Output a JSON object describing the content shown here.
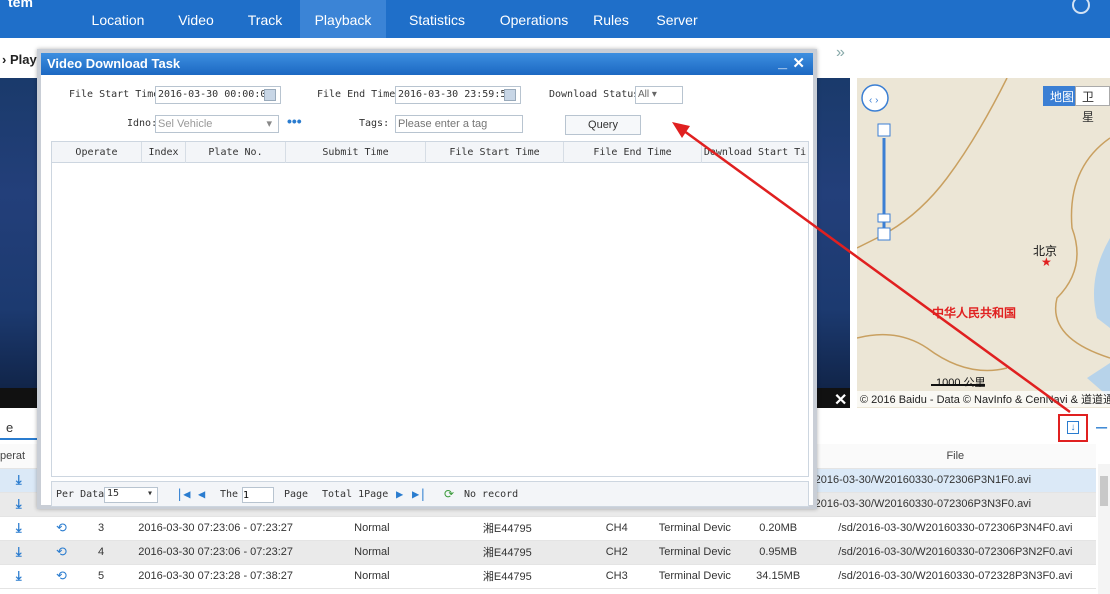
{
  "nav": {
    "brand": "tem",
    "items": [
      "Location",
      "Video",
      "Track",
      "Playback",
      "Statistics",
      "Operations",
      "Rules",
      "Server"
    ],
    "active": "Playback"
  },
  "page": {
    "play_tab": "Play",
    "lower_tab": "e",
    "collapse": "»"
  },
  "map": {
    "btn_map": "地图",
    "btn_sat": "卫星",
    "beijing": "北京",
    "country": "中华人民共和国",
    "scale": "1000 公里",
    "copyright": "© 2016 Baidu - Data © NavInfo & CenNavi & 道道通"
  },
  "modal": {
    "title": "Video Download Task",
    "file_start_label": "File Start Time:",
    "file_start_value": "2016-03-30 00:00:00",
    "file_end_label": "File End Time:",
    "file_end_value": "2016-03-30 23:59:59",
    "download_status_label": "Download Status:",
    "download_status_value": "All",
    "idno_label": "Idno:",
    "idno_placeholder": "Sel Vehicle",
    "tags_label": "Tags:",
    "tags_placeholder": "Please enter a tag",
    "query_label": "Query",
    "columns": [
      "Operate",
      "Index",
      "Plate No.",
      "Submit Time",
      "File Start Time",
      "File End Time",
      "Download Start Ti"
    ],
    "pager": {
      "per_data_label": "Per Data",
      "per_data_value": "15",
      "the_label": "The",
      "page_value": "1",
      "page_label": "Page",
      "total": "Total 1Page",
      "status": "No record"
    }
  },
  "file_table": {
    "headers": [
      "perat",
      "",
      "",
      "",
      "",
      "",
      "",
      "",
      "",
      "File"
    ],
    "rows": [
      {
        "index": "",
        "time": "",
        "type": "",
        "plate": "",
        "channel": "",
        "source": "",
        "size": "",
        "file": "2016-03-30/W20160330-072306P3N1F0.avi"
      },
      {
        "index": "",
        "time": "",
        "type": "",
        "plate": "",
        "channel": "",
        "source": "",
        "size": "",
        "file": "2016-03-30/W20160330-072306P3N3F0.avi"
      },
      {
        "index": "3",
        "time": "2016-03-30 07:23:06 - 07:23:27",
        "type": "Normal",
        "plate": "湘E44795",
        "channel": "CH4",
        "source": "Terminal Devic",
        "size": "0.20MB",
        "file": "/sd/2016-03-30/W20160330-072306P3N4F0.avi"
      },
      {
        "index": "4",
        "time": "2016-03-30 07:23:06 - 07:23:27",
        "type": "Normal",
        "plate": "湘E44795",
        "channel": "CH2",
        "source": "Terminal Devic",
        "size": "0.95MB",
        "file": "/sd/2016-03-30/W20160330-072306P3N2F0.avi"
      },
      {
        "index": "5",
        "time": "2016-03-30 07:23:28 - 07:38:27",
        "type": "Normal",
        "plate": "湘E44795",
        "channel": "CH3",
        "source": "Terminal Devic",
        "size": "34.15MB",
        "file": "/sd/2016-03-30/W20160330-072328P3N3F0.avi"
      }
    ]
  },
  "icons": {
    "download": "download-icon",
    "replay": "replay-icon",
    "calendar": "calendar-icon",
    "refresh": "refresh-icon"
  },
  "colors": {
    "nav_bg": "#1f6fc9",
    "nav_active": "#3b84d6",
    "modal_title": "#1c68c2",
    "annotation": "#e02020"
  }
}
